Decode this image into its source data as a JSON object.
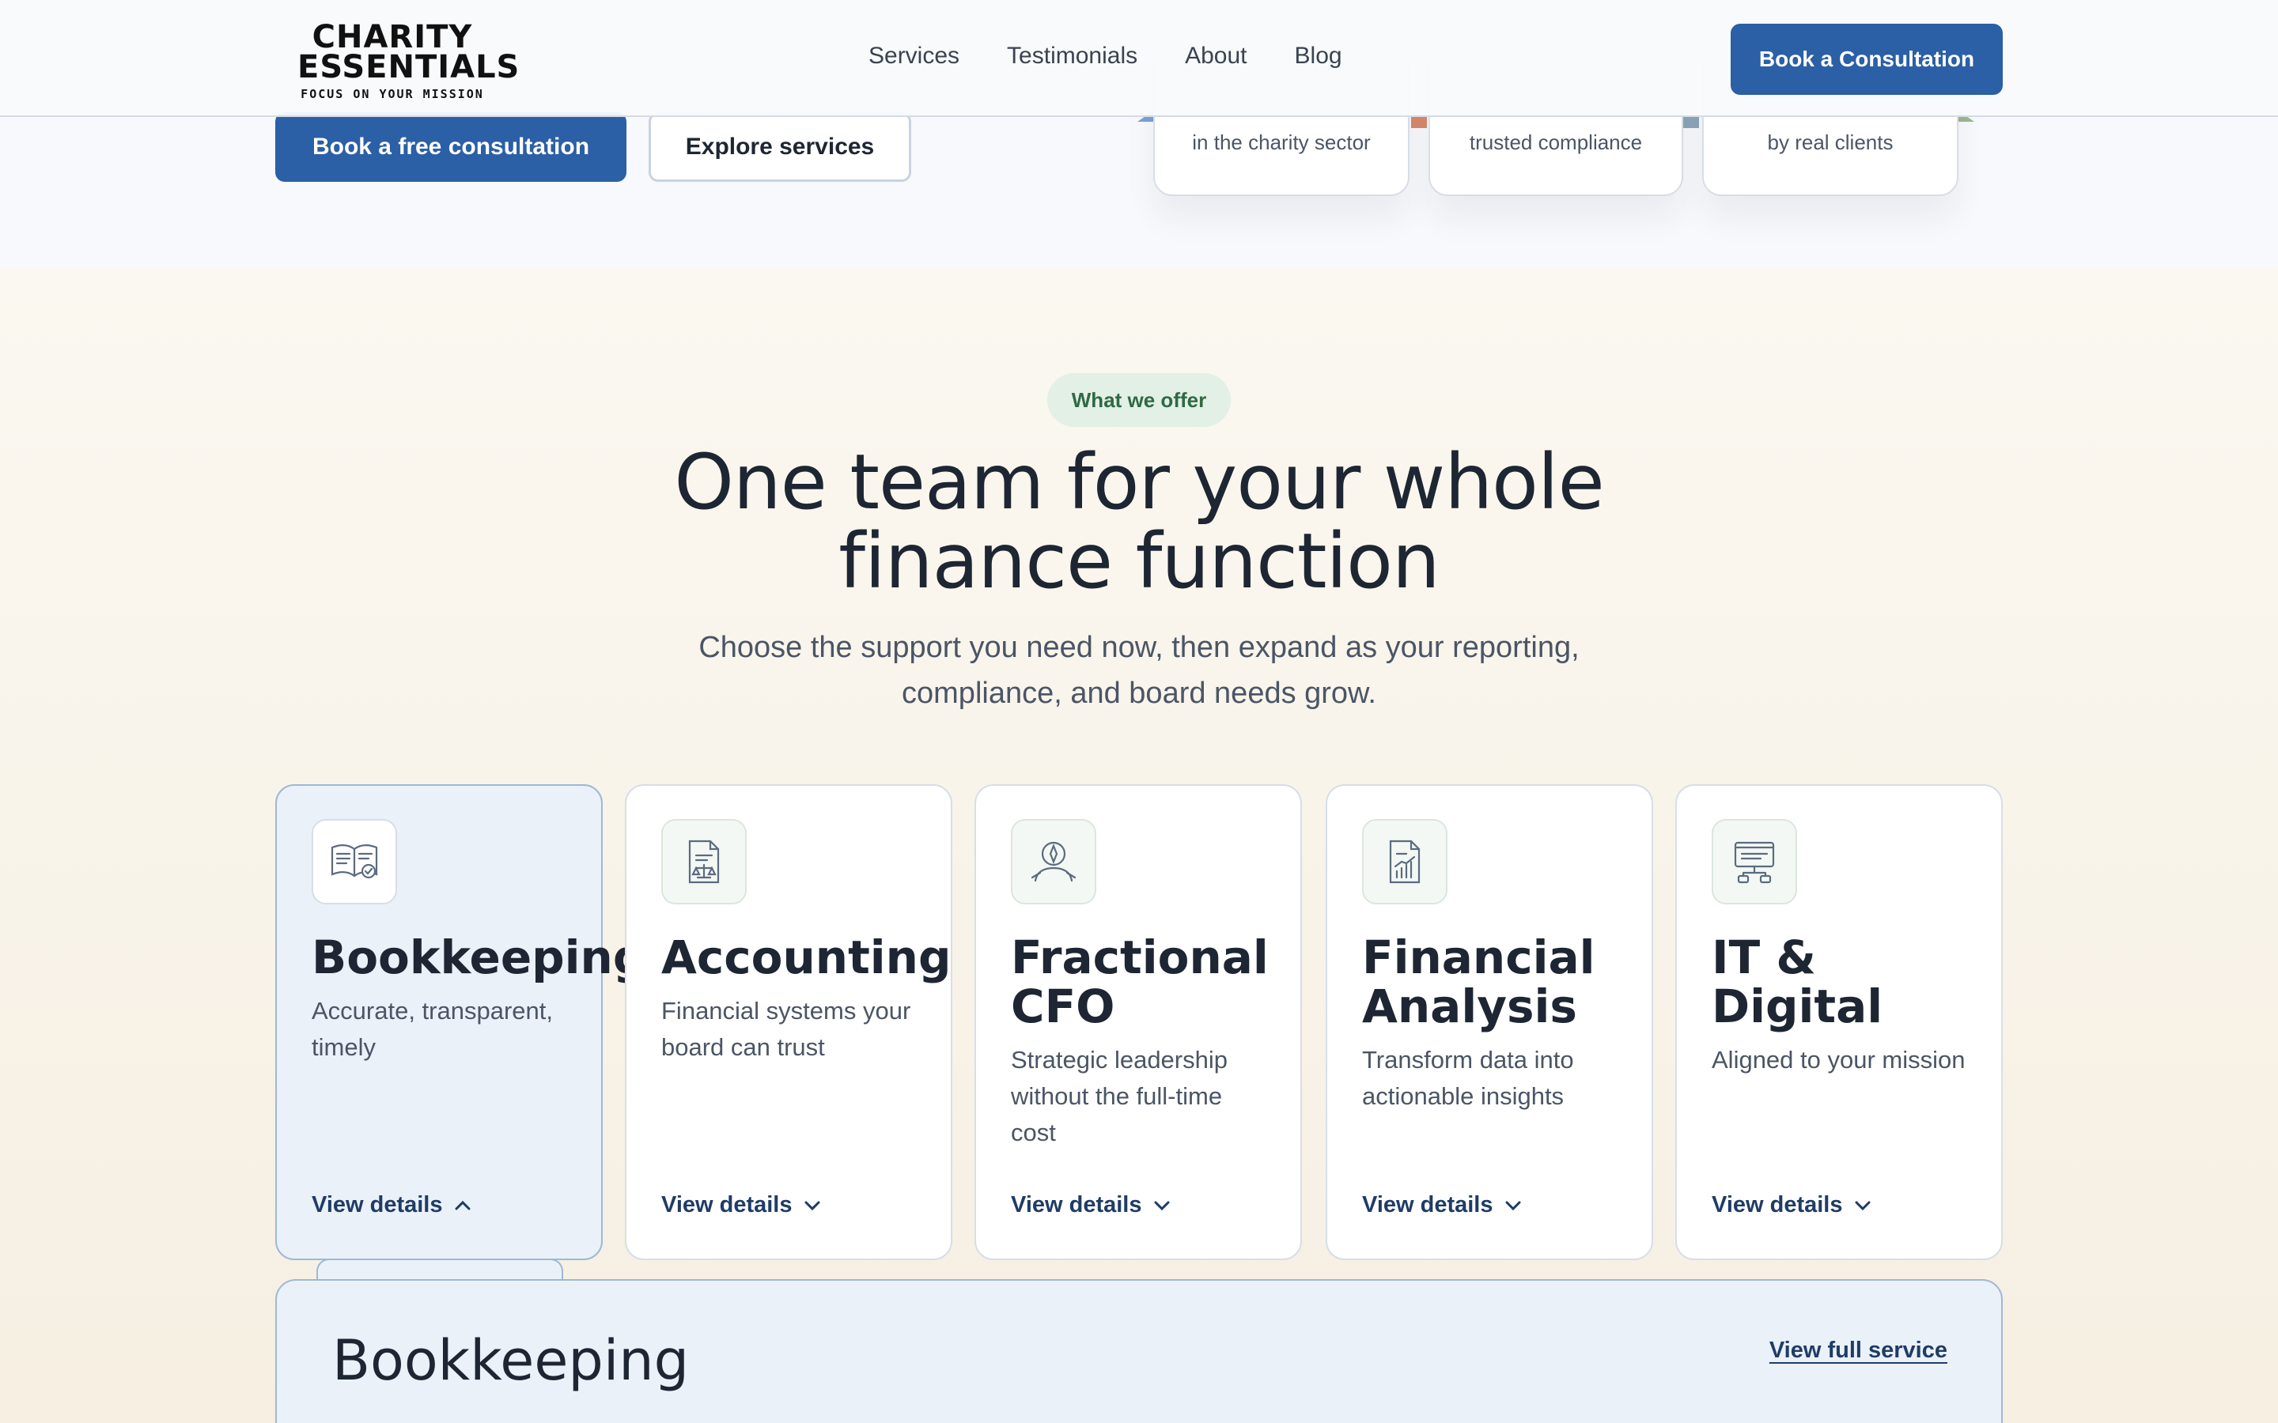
{
  "header": {
    "logo_line1": "CHARITY",
    "logo_line2": "ESSENTIALS",
    "logo_tagline": "FOCUS ON YOUR MISSION",
    "nav": [
      "Services",
      "Testimonials",
      "About",
      "Blog"
    ],
    "cta_label": "Book a Consultation"
  },
  "hero": {
    "primary_button": "Book a free consultation",
    "secondary_button": "Explore services",
    "stats": [
      {
        "caption": "in the charity sector"
      },
      {
        "caption": "trusted compliance"
      },
      {
        "caption": "by real clients"
      }
    ]
  },
  "services": {
    "eyebrow": "What we offer",
    "headline": "One team for your whole finance function",
    "subhead": "Choose the support you need now, then expand as your reporting, compliance, and board needs grow.",
    "cards": [
      {
        "title": "Bookkeeping",
        "description": "Accurate, transparent, timely",
        "link": "View details",
        "icon": "open-book-icon",
        "expanded": true
      },
      {
        "title": "Accounting",
        "description": "Financial systems your board can trust",
        "link": "View details",
        "icon": "document-scale-icon",
        "expanded": false
      },
      {
        "title": "Fractional CFO",
        "description": "Strategic leadership without the full-time cost",
        "link": "View details",
        "icon": "person-compass-icon",
        "expanded": false
      },
      {
        "title": "Financial Analysis",
        "description": "Transform data into actionable insights",
        "link": "View details",
        "icon": "document-chart-icon",
        "expanded": false
      },
      {
        "title": "IT & Digital",
        "description": "Aligned to your mission",
        "link": "View details",
        "icon": "network-screen-icon",
        "expanded": false
      }
    ],
    "detail_panel": {
      "title": "Bookkeeping",
      "link": "View full service"
    }
  },
  "colors": {
    "primary": "#2b5fa6",
    "accent_green": "#2f6a45",
    "active_card": "#eaf1f9"
  }
}
